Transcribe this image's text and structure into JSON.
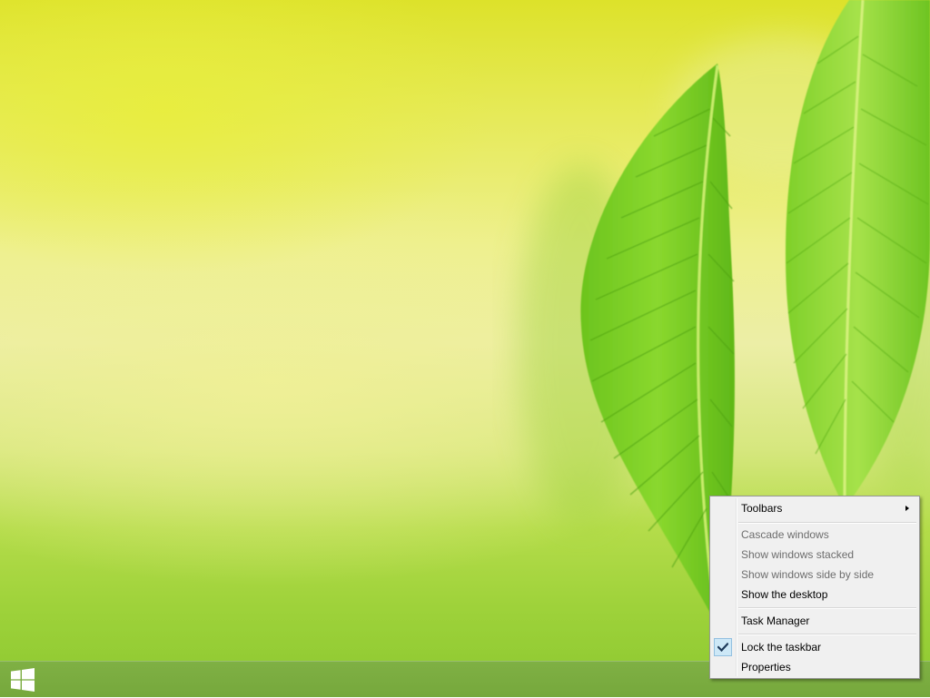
{
  "desktop": {
    "wallpaper": "green fern leaves on yellow-green background"
  },
  "taskbar": {
    "color": "#78aa3e",
    "start_icon": "windows-logo-icon"
  },
  "context_menu": {
    "items": [
      {
        "label": "Toolbars",
        "enabled": true,
        "has_submenu": true
      },
      {
        "label": "Cascade windows",
        "enabled": false
      },
      {
        "label": "Show windows stacked",
        "enabled": false
      },
      {
        "label": "Show windows side by side",
        "enabled": false
      },
      {
        "label": "Show the desktop",
        "enabled": true
      },
      {
        "label": "Task Manager",
        "enabled": true
      },
      {
        "label": "Lock the taskbar",
        "enabled": true,
        "checked": true
      },
      {
        "label": "Properties",
        "enabled": true
      }
    ],
    "check_color": "#1e3a5a",
    "check_bg": "#cde8f7"
  }
}
